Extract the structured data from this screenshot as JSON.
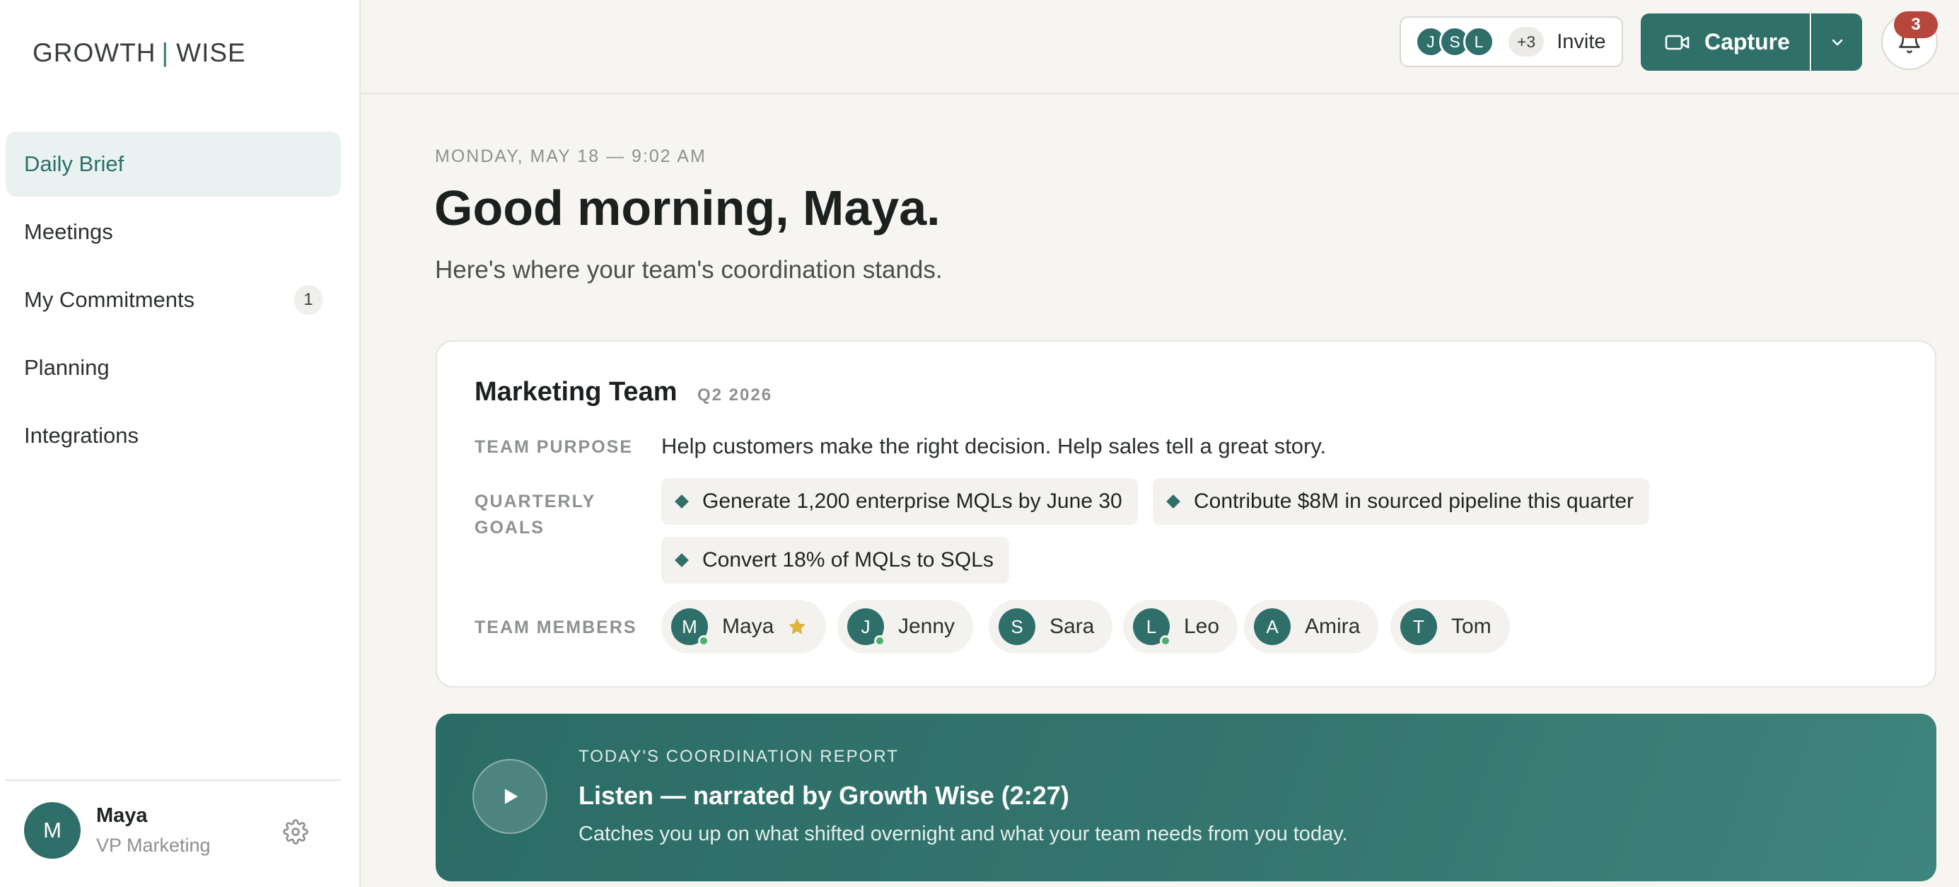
{
  "app": {
    "logo_left": "GROWTH",
    "logo_sep": "|",
    "logo_right": "WISE"
  },
  "sidebar": {
    "items": [
      {
        "label": "Daily Brief",
        "active": true
      },
      {
        "label": "Meetings"
      },
      {
        "label": "My Commitments",
        "badge": "1"
      },
      {
        "label": "Planning"
      },
      {
        "label": "Integrations"
      }
    ],
    "user": {
      "initial": "M",
      "name": "Maya",
      "role": "VP Marketing"
    }
  },
  "topbar": {
    "invite": {
      "avatars": [
        "J",
        "S",
        "L"
      ],
      "more": "+3",
      "label": "Invite"
    },
    "capture_label": "Capture",
    "notification_count": "3"
  },
  "header": {
    "date": "MONDAY, MAY 18 — 9:02 AM",
    "greeting": "Good morning, Maya.",
    "subtitle": "Here's where your team's coordination stands."
  },
  "team": {
    "name": "Marketing Team",
    "quarter": "Q2 2026",
    "purpose_label": "TEAM PURPOSE",
    "purpose": "Help customers make the right decision. Help sales tell a great story.",
    "goals_label_line1": "QUARTERLY",
    "goals_label_line2": "GOALS",
    "goals": [
      "Generate 1,200 enterprise MQLs by June 30",
      "Contribute $8M in sourced pipeline this quarter",
      "Convert 18% of MQLs to SQLs"
    ],
    "members_label": "TEAM MEMBERS",
    "members": [
      {
        "initial": "M",
        "name": "Maya",
        "online": true,
        "starred": true
      },
      {
        "initial": "J",
        "name": "Jenny",
        "online": true
      },
      {
        "initial": "S",
        "name": "Sara"
      },
      {
        "initial": "L",
        "name": "Leo",
        "online": true
      },
      {
        "initial": "A",
        "name": "Amira"
      },
      {
        "initial": "T",
        "name": "Tom"
      }
    ]
  },
  "report": {
    "kicker": "TODAY'S COORDINATION REPORT",
    "title": "Listen — narrated by Growth Wise (2:27)",
    "description": "Catches you up on what shifted overnight and what your team needs from you today."
  },
  "colors": {
    "accent": "#2f7069",
    "star": "#e0b43c",
    "badge": "#b7473d",
    "online": "#4caf6c"
  }
}
